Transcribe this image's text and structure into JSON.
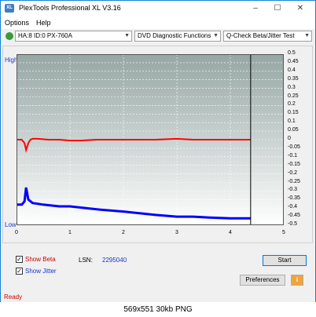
{
  "window": {
    "title": "PlexTools Professional XL V3.16",
    "icon_text": "XL",
    "minimize": "–",
    "maximize": "☐",
    "close": "✕"
  },
  "menu": {
    "options": "Options",
    "help": "Help"
  },
  "toolbar": {
    "drive": "HA:8 ID:0  PX-760A",
    "function": "DVD Diagnostic Functions",
    "test": "Q-Check Beta/Jitter Test"
  },
  "chart_data": {
    "type": "line",
    "label_high": "High",
    "label_low": "Low",
    "x_ticks": [
      "0",
      "1",
      "2",
      "3",
      "4",
      "5"
    ],
    "xlim": [
      0,
      5
    ],
    "y_ticks": [
      "0.5",
      "0.45",
      "0.4",
      "0.35",
      "0.3",
      "0.25",
      "0.2",
      "0.15",
      "0.1",
      "0.05",
      "0",
      "-0.05",
      "-0.1",
      "-0.15",
      "-0.2",
      "-0.25",
      "-0.3",
      "-0.35",
      "-0.4",
      "-0.45",
      "-0.5"
    ],
    "ylim": [
      -0.5,
      0.5
    ],
    "end_marker_x": 4.38,
    "colors": {
      "beta": "#ff0000",
      "jitter": "#0000ff",
      "background_top": "#95a6a3",
      "background_bottom": "#ffffff",
      "grid": "#ffffff"
    },
    "series": [
      {
        "key": "beta",
        "x": [
          0.0,
          0.05,
          0.1,
          0.15,
          0.18,
          0.22,
          0.26,
          0.3,
          0.4,
          0.6,
          0.8,
          1.0,
          1.2,
          1.5,
          1.8,
          2.0,
          2.3,
          2.6,
          3.0,
          3.3,
          3.6,
          4.0,
          4.38
        ],
        "values": [
          0.0,
          0.0,
          0.0,
          -0.02,
          -0.06,
          -0.02,
          0.0,
          0.005,
          0.005,
          0.0,
          0.0,
          -0.005,
          -0.005,
          0.0,
          0.0,
          0.0,
          0.0,
          0.0,
          0.005,
          0.0,
          0.0,
          0.0,
          0.0
        ]
      },
      {
        "key": "jitter",
        "x": [
          0.0,
          0.1,
          0.15,
          0.18,
          0.22,
          0.3,
          0.5,
          0.8,
          1.0,
          1.3,
          1.6,
          2.0,
          2.3,
          2.6,
          3.0,
          3.3,
          3.6,
          4.0,
          4.38
        ],
        "values": [
          -0.38,
          -0.38,
          -0.36,
          -0.28,
          -0.35,
          -0.37,
          -0.38,
          -0.39,
          -0.39,
          -0.4,
          -0.41,
          -0.42,
          -0.43,
          -0.44,
          -0.45,
          -0.45,
          -0.455,
          -0.46,
          -0.46
        ]
      }
    ]
  },
  "bottom": {
    "show_beta": "Show Beta",
    "show_jitter": "Show Jitter",
    "lsn_label": "LSN:",
    "lsn_value": "2295040",
    "start": "Start",
    "preferences": "Preferences"
  },
  "status": "Ready",
  "caption": "569x551  30kb  PNG"
}
